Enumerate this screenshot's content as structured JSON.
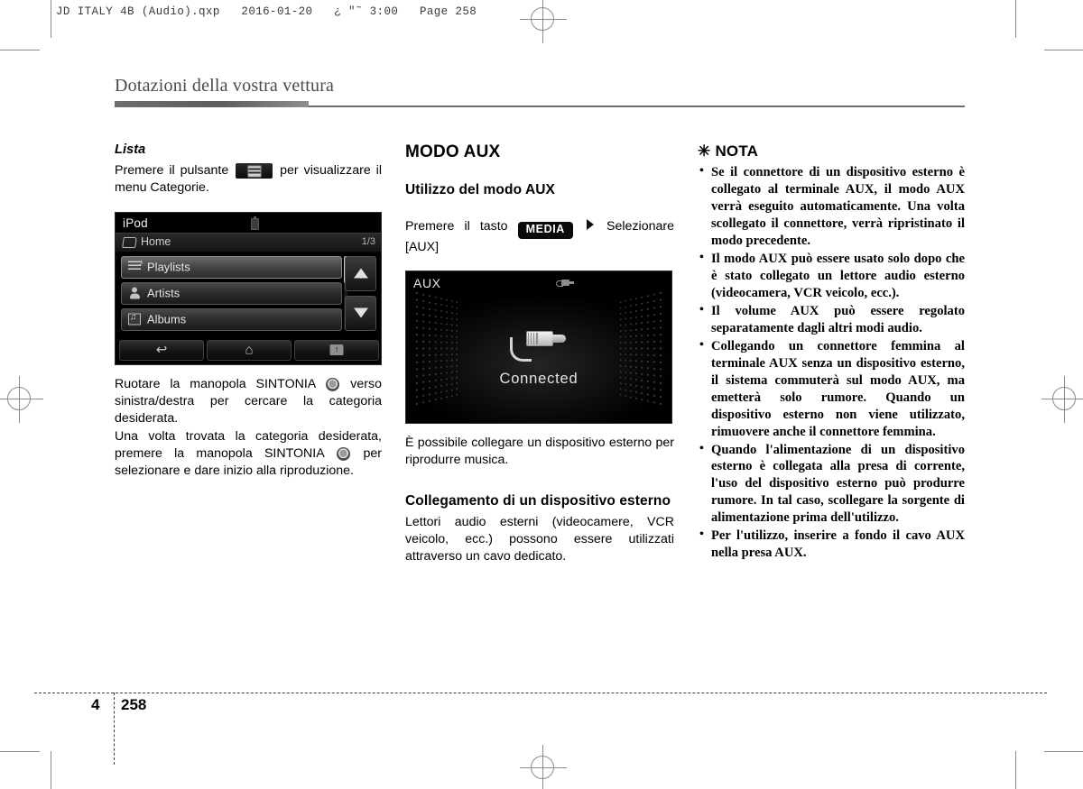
{
  "print_slug": "JD ITALY 4B (Audio).qxp   2016-01-20   ¿ \"˜ 3:00   Page 258",
  "chapter_title": "Dotazioni della vostra vettura",
  "footer": {
    "chapter_number": "4",
    "page_number": "258"
  },
  "column_left": {
    "heading": "Lista",
    "para_before_badge": "Premere il pulsante",
    "para_after_badge": "per visualizzare il menu Categorie.",
    "list_button_icon": "list-lines-icon",
    "device": {
      "title": "iPod",
      "battery_icon": "battery-icon",
      "folder_icon": "folder-icon",
      "breadcrumb": "Home",
      "page_indicator": "1/3",
      "rows": [
        {
          "label": "Playlists",
          "icon": "playlist-icon",
          "selected": true
        },
        {
          "label": "Artists",
          "icon": "artist-icon",
          "selected": false
        },
        {
          "label": "Albums",
          "icon": "album-icon",
          "selected": false
        }
      ],
      "scroll_up_icon": "triangle-up-icon",
      "scroll_down_icon": "triangle-down-icon",
      "toolbar": [
        {
          "icon": "back-arrow-icon",
          "glyph": "↩"
        },
        {
          "icon": "home-icon",
          "glyph": "⌂"
        },
        {
          "icon": "folder-up-icon",
          "glyph": ""
        }
      ]
    },
    "para_knob_1a": "Ruotare la manopola SINTONIA",
    "para_knob_1b": "verso sinistra/destra per cercare la categoria desiderata.",
    "para_knob_2a": "Una volta trovata la categoria desiderata, premere la manopola SINTONIA",
    "para_knob_2b": "per selezionare e dare inizio alla riproduzione.",
    "knob_icon": "tuning-knob-icon"
  },
  "column_middle": {
    "heading": "MODO AUX",
    "subheading": "Utilizzo del modo AUX",
    "instruction_prefix": "Premere il tasto",
    "media_badge": "MEDIA",
    "arrow_icon": "triangle-right-icon",
    "instruction_suffix": "Selezionare [AUX]",
    "device": {
      "title": "AUX",
      "top_icon": "aux-plug-small-icon",
      "plug_icon": "aux-plug-icon",
      "status": "Connected"
    },
    "para_after_device": "È possibile collegare un dispositivo esterno per riprodurre musica.",
    "subheading2": "Collegamento di un dispositivo esterno",
    "para_final": "Lettori audio esterni (videocamere, VCR veicolo, ecc.) possono essere utilizzati attraverso un cavo dedicato."
  },
  "column_right": {
    "nota_icon": "✳",
    "nota_title": "NOTA",
    "bullets": [
      "Se il connettore di un dispositivo esterno è collegato al terminale AUX, il modo AUX verrà eseguito automaticamente. Una volta scollegato il connettore, verrà ripristinato il modo precedente.",
      "Il modo AUX può essere usato solo dopo che è stato collegato un lettore audio esterno (videocamera, VCR veicolo, ecc.).",
      "Il volume AUX può essere regolato separatamente dagli altri modi audio.",
      "Collegando un connettore femmina al terminale AUX senza un dispositivo esterno, il sistema commuterà sul modo AUX, ma emetterà solo rumore. Quando un dispositivo esterno non viene utilizzato, rimuovere anche il connettore femmina.",
      "Quando l'alimentazione di un dispositivo esterno è collegata alla presa di corrente, l'uso del dispositivo esterno può produrre rumore. In tal caso, scollegare la sorgente di alimentazione prima dell'utilizzo.",
      "Per l'utilizzo, inserire a fondo il cavo AUX nella presa AUX."
    ]
  }
}
